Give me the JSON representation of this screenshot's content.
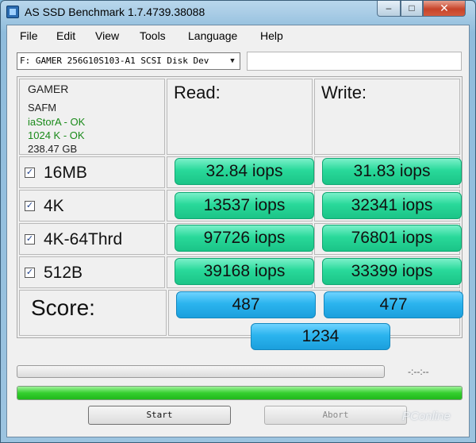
{
  "window": {
    "title": "AS SSD Benchmark 1.7.4739.38088",
    "minimize_glyph": "–",
    "maximize_glyph": "□",
    "close_glyph": "✕"
  },
  "menu": [
    "File",
    "Edit",
    "View",
    "Tools",
    "Language",
    "Help"
  ],
  "drive": {
    "selected": "F: GAMER 256G10S103-A1 SCSI Disk Dev",
    "arrow_glyph": "▼"
  },
  "info": {
    "name": "GAMER",
    "model": "SAFM",
    "driver": "iaStorA - OK",
    "alignment": "1024 K - OK",
    "size": "238.47 GB"
  },
  "headers": {
    "read": "Read:",
    "write": "Write:"
  },
  "tests": [
    {
      "label": "16MB",
      "checked": "✓",
      "read": "32.84 iops",
      "write": "31.83 iops"
    },
    {
      "label": "4K",
      "checked": "✓",
      "read": "13537 iops",
      "write": "32341 iops"
    },
    {
      "label": "4K-64Thrd",
      "checked": "✓",
      "read": "97726 iops",
      "write": "76801 iops"
    },
    {
      "label": "512B",
      "checked": "✓",
      "read": "39168 iops",
      "write": "33399 iops"
    }
  ],
  "score": {
    "label": "Score:",
    "read": "487",
    "write": "477",
    "total": "1234"
  },
  "progress": {
    "timer": "-:--:--",
    "overall_fraction": 1.0
  },
  "buttons": {
    "start": "Start",
    "abort": "Abort"
  },
  "watermark": "PConline",
  "colors": {
    "result_green": "#2fdb9e",
    "score_blue": "#2bb4ee",
    "progress_green": "#35cf2f"
  }
}
